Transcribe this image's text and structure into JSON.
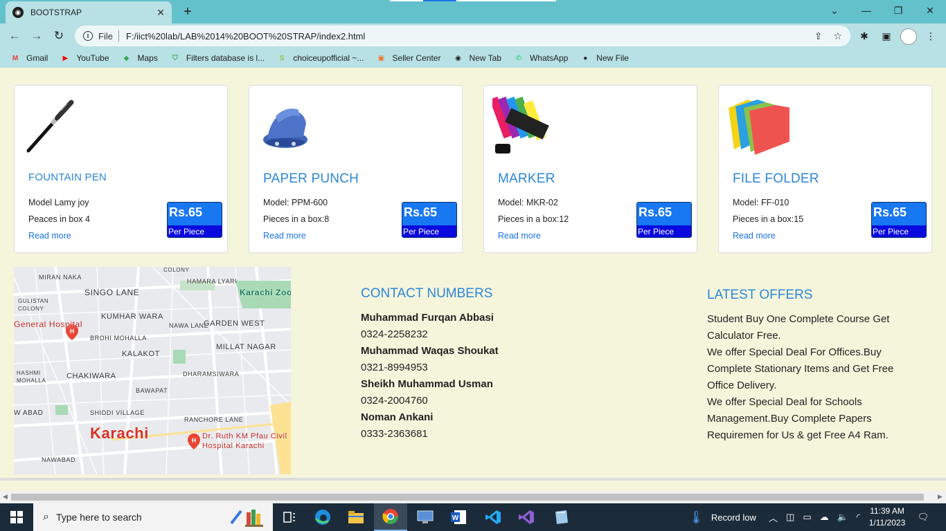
{
  "browser": {
    "tab_title": "BOOTSTRAP",
    "url_scheme": "File",
    "url": "F:/iict%20lab/LAB%2014%20BOOT%20STRAP/index2.html"
  },
  "bookmarks": [
    {
      "label": "Gmail",
      "icon": "gmail-icon",
      "color": "#ea4335"
    },
    {
      "label": "YouTube",
      "icon": "youtube-icon",
      "color": "#ff0000"
    },
    {
      "label": "Maps",
      "icon": "maps-icon",
      "color": "#34a853"
    },
    {
      "label": "Filters database is l...",
      "icon": "shield-icon",
      "color": "#3aa757"
    },
    {
      "label": "choiceupofficial ~...",
      "icon": "shopify-icon",
      "color": "#95bf47"
    },
    {
      "label": "Seller Center",
      "icon": "store-icon",
      "color": "#f57224"
    },
    {
      "label": "New Tab",
      "icon": "globe-icon",
      "color": "#222222"
    },
    {
      "label": "WhatsApp",
      "icon": "whatsapp-icon",
      "color": "#25d366"
    },
    {
      "label": "New File",
      "icon": "github-icon",
      "color": "#222222"
    }
  ],
  "products": [
    {
      "title": "FOUNTAIN PEN",
      "model": "Model Lamy joy",
      "pieces": "Peaces in box 4",
      "link": "Read more",
      "price": "Rs.65",
      "unit": "Per Piece",
      "image": "pen-image"
    },
    {
      "title": "PAPER PUNCH",
      "model": "Model: PPM-600",
      "pieces": "Pieces in a box:8",
      "link": "Read more",
      "price": "Rs.65",
      "unit": "Per Piece",
      "image": "punch-image"
    },
    {
      "title": "MARKER",
      "model": "Model: MKR-02",
      "pieces": "Pieces in a box:12",
      "link": "Read more",
      "price": "Rs.65",
      "unit": "Per Piece",
      "image": "marker-image"
    },
    {
      "title": "FILE FOLDER",
      "model": "Model: FF-010",
      "pieces": "Pieces in a box:15",
      "link": "Read more",
      "price": "Rs.65",
      "unit": "Per Piece",
      "image": "folder-image"
    }
  ],
  "map": {
    "labels": [
      "COLONY",
      "MIRAN NAKA",
      "HAMARA LYARI",
      "Karachi Zoo",
      "SINGO LANE",
      "GULISTAN COLONY",
      "KUMHAR WARA",
      "NAWA LANE",
      "GARDEN WEST",
      "General Hospital",
      "BROHI MOHALLA",
      "MILLAT NAGAR",
      "KALAKOT",
      "HASHMI MOHALLA",
      "CHAKIWARA",
      "DHARAMSIWARA",
      "BAWAPAT",
      "W ABAD",
      "SHIDDI VILLAGE",
      "RANCHORE LANE",
      "Karachi",
      "Dr. Ruth KM Pfau Civil Hospital Karachi",
      "NAWABAD"
    ]
  },
  "contacts": {
    "title": "CONTACT NUMBERS",
    "people": [
      {
        "name": "Muhammad Furqan Abbasi",
        "phone": "0324-2258232"
      },
      {
        "name": "Muhammad Waqas Shoukat",
        "phone": "0321-8994953"
      },
      {
        "name": "Sheikh Muhammad Usman",
        "phone": "0324-2004760"
      },
      {
        "name": "Noman Ankani",
        "phone": "0333-2363681"
      }
    ]
  },
  "offers": {
    "title": "LATEST OFFERS",
    "lines": [
      "Student Buy One Complete Course Get",
      "Calculator Free.",
      "We offer Special Deal For Offices.Buy",
      "Complete Stationary Items and Get Free",
      "Office Delivery.",
      "We offer Special Deal for Schools",
      "Management.Buy Complete Papers",
      "Requiremen for Us & get Free A4 Ram."
    ]
  },
  "taskbar": {
    "search_placeholder": "Type here to search",
    "weather": "Record low",
    "time": "11:39 AM",
    "date": "1/11/2023"
  },
  "colors": {
    "accent": "#2b87d8",
    "price_bg": "#1877f2",
    "price_unit_bg": "#0a0adf",
    "page_bg": "#f5f5dc",
    "chrome_frame": "#63c1cc"
  }
}
